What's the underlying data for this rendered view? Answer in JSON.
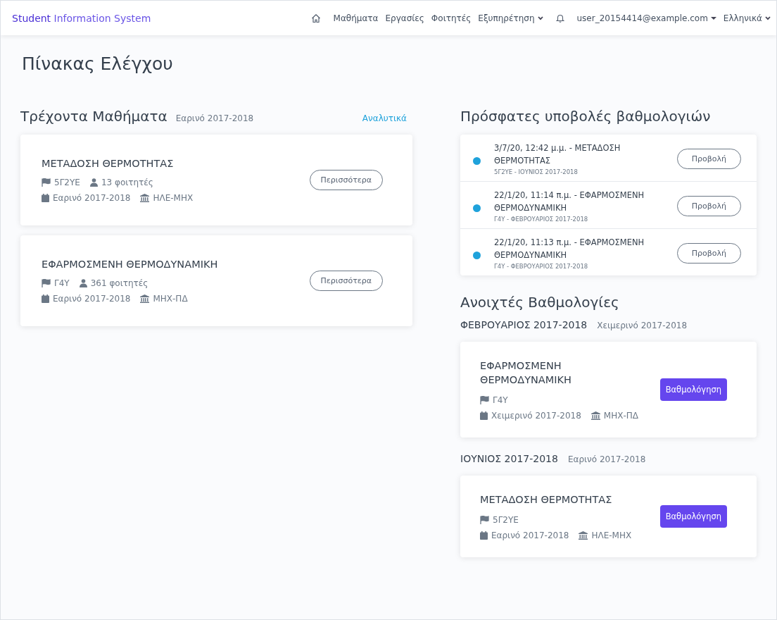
{
  "navbar": {
    "brand": {
      "primary": "Student",
      "secondary": "Information System"
    },
    "items": [
      {
        "kind": "home"
      },
      {
        "kind": "link",
        "label": "Μαθήματα"
      },
      {
        "kind": "link",
        "label": "Εργασίες"
      },
      {
        "kind": "link",
        "label": "Φοιτητές"
      },
      {
        "kind": "dropdown",
        "label": "Εξυπηρέτηση"
      },
      {
        "kind": "bell"
      },
      {
        "kind": "account",
        "label": "user_20154414@example.com"
      },
      {
        "kind": "dropdown",
        "label": "Ελληνικά"
      }
    ]
  },
  "page_title": "Πίνακας Ελέγχου",
  "current_courses": {
    "title": "Τρέχοντα Μαθήματα",
    "period": "Εαρινό 2017-2018",
    "link": "Αναλυτικά",
    "courses": [
      {
        "name": "ΜΕΤΑΔΟΣΗ ΘΕΡΜΟΤΗΤΑΣ",
        "code": "5Γ2ΥΕ",
        "students": "13 φοιτητές",
        "semester": "Εαρινό 2017-2018",
        "department": "ΗΛΕ-ΜΗΧ",
        "button": "Περισσότερα"
      },
      {
        "name": "ΕΦΑΡΜΟΣΜΕΝΗ ΘΕΡΜΟΔΥΝΑΜΙΚΗ",
        "code": "Γ4Υ",
        "students": "361 φοιτητές",
        "semester": "Εαρινό 2017-2018",
        "department": "ΜΗΧ-ΠΔ",
        "button": "Περισσότερα"
      }
    ]
  },
  "recent_submissions": {
    "title": "Πρόσφατες υποβολές βαθμολογιών",
    "items": [
      {
        "title": "3/7/20, 12:42 μ.μ. - ΜΕΤΑΔΟΣΗ ΘΕΡΜΟΤΗΤΑΣ",
        "subtitle": "5Γ2ΥΕ - ΙΟΥΝΙΟΣ 2017-2018",
        "color": "#1fa2db",
        "button": "Προβολή"
      },
      {
        "title": "22/1/20, 11:14 π.μ. - ΕΦΑΡΜΟΣΜΕΝΗ ΘΕΡΜΟΔΥΝΑΜΙΚΗ",
        "subtitle": "Γ4Υ - ΦΕΒΡΟΥΑΡΙΟΣ 2017-2018",
        "color": "#1fa2db",
        "button": "Προβολή"
      },
      {
        "title": "22/1/20, 11:13 π.μ. - ΕΦΑΡΜΟΣΜΕΝΗ ΘΕΡΜΟΔΥΝΑΜΙΚΗ",
        "subtitle": "Γ4Υ - ΦΕΒΡΟΥΑΡΙΟΣ 2017-2018",
        "color": "#1fa2db",
        "button": "Προβολή"
      }
    ]
  },
  "open_gradings": {
    "title": "Ανοιχτές Βαθμολογίες",
    "groups": [
      {
        "exam_period": "ΦΕΒΡΟΥΑΡΙΟΣ 2017-2018",
        "semester_label": "Χειμερινό 2017-2018",
        "course": {
          "name": "ΕΦΑΡΜΟΣΜΕΝΗ ΘΕΡΜΟΔΥΝΑΜΙΚΗ",
          "code": "Γ4Υ",
          "semester": "Χειμερινό 2017-2018",
          "department": "ΜΗΧ-ΠΔ",
          "button": "Βαθμολόγηση"
        }
      },
      {
        "exam_period": "ΙΟΥΝΙΟΣ 2017-2018",
        "semester_label": "Εαρινό 2017-2018",
        "course": {
          "name": "ΜΕΤΑΔΟΣΗ ΘΕΡΜΟΤΗΤΑΣ",
          "code": "5Γ2ΥΕ",
          "semester": "Εαρινό 2017-2018",
          "department": "ΗΛΕ-ΜΗΧ",
          "button": "Βαθμολόγηση"
        }
      }
    ]
  }
}
